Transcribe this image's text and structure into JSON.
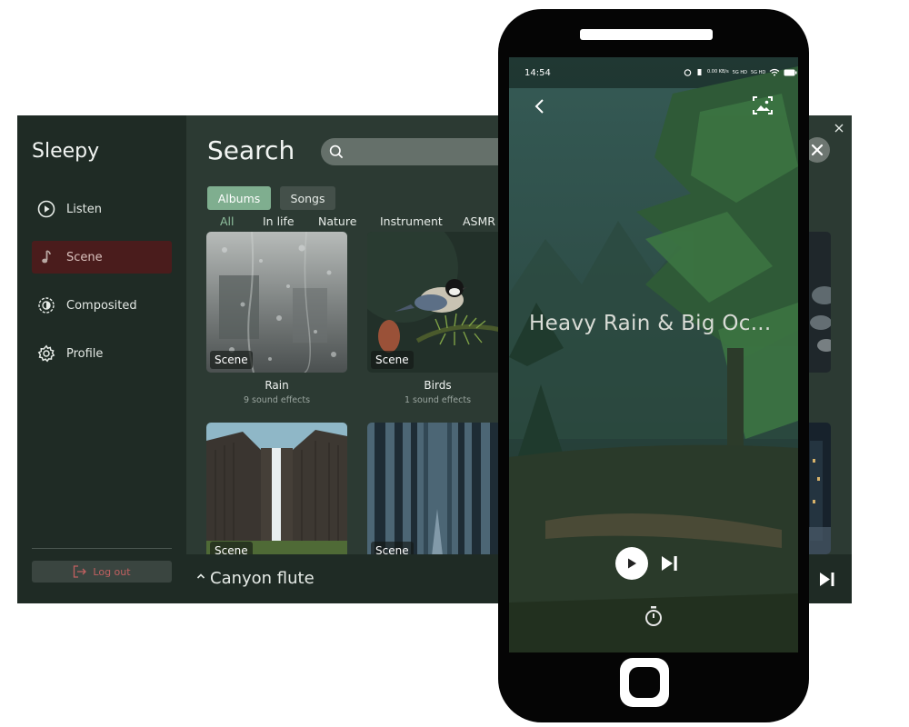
{
  "app": {
    "title": "Sleepy"
  },
  "sidebar": {
    "items": [
      {
        "label": "Listen",
        "icon": "play-circle-icon"
      },
      {
        "label": "Scene",
        "icon": "music-note-icon",
        "active": true
      },
      {
        "label": "Composited",
        "icon": "composite-icon"
      },
      {
        "label": "Profile",
        "icon": "gear-icon"
      }
    ],
    "logout_label": "Log out"
  },
  "search": {
    "title": "Search",
    "placeholder": ""
  },
  "toggles": {
    "albums": "Albums",
    "songs": "Songs"
  },
  "categories": [
    "All",
    "In life",
    "Nature",
    "Instrument",
    "ASMR"
  ],
  "cards": [
    {
      "badge": "Scene",
      "title": "Rain",
      "subtitle": "9 sound effects"
    },
    {
      "badge": "Scene",
      "title": "Birds",
      "subtitle": "1 sound effects"
    },
    {
      "badge": "Scene"
    },
    {
      "badge": "Scene"
    }
  ],
  "player_bar": {
    "now_playing": "Canyon flute"
  },
  "phone": {
    "status_time": "14:54",
    "status_speed": "0.00 KB/s",
    "status_network_1": "5G HD",
    "status_network_2": "5G HD",
    "track_title": "Heavy Rain & Big Oc..."
  },
  "colors": {
    "accent": "#7fae8f",
    "active_nav": "#4a1c1c",
    "logout": "#c06060"
  }
}
